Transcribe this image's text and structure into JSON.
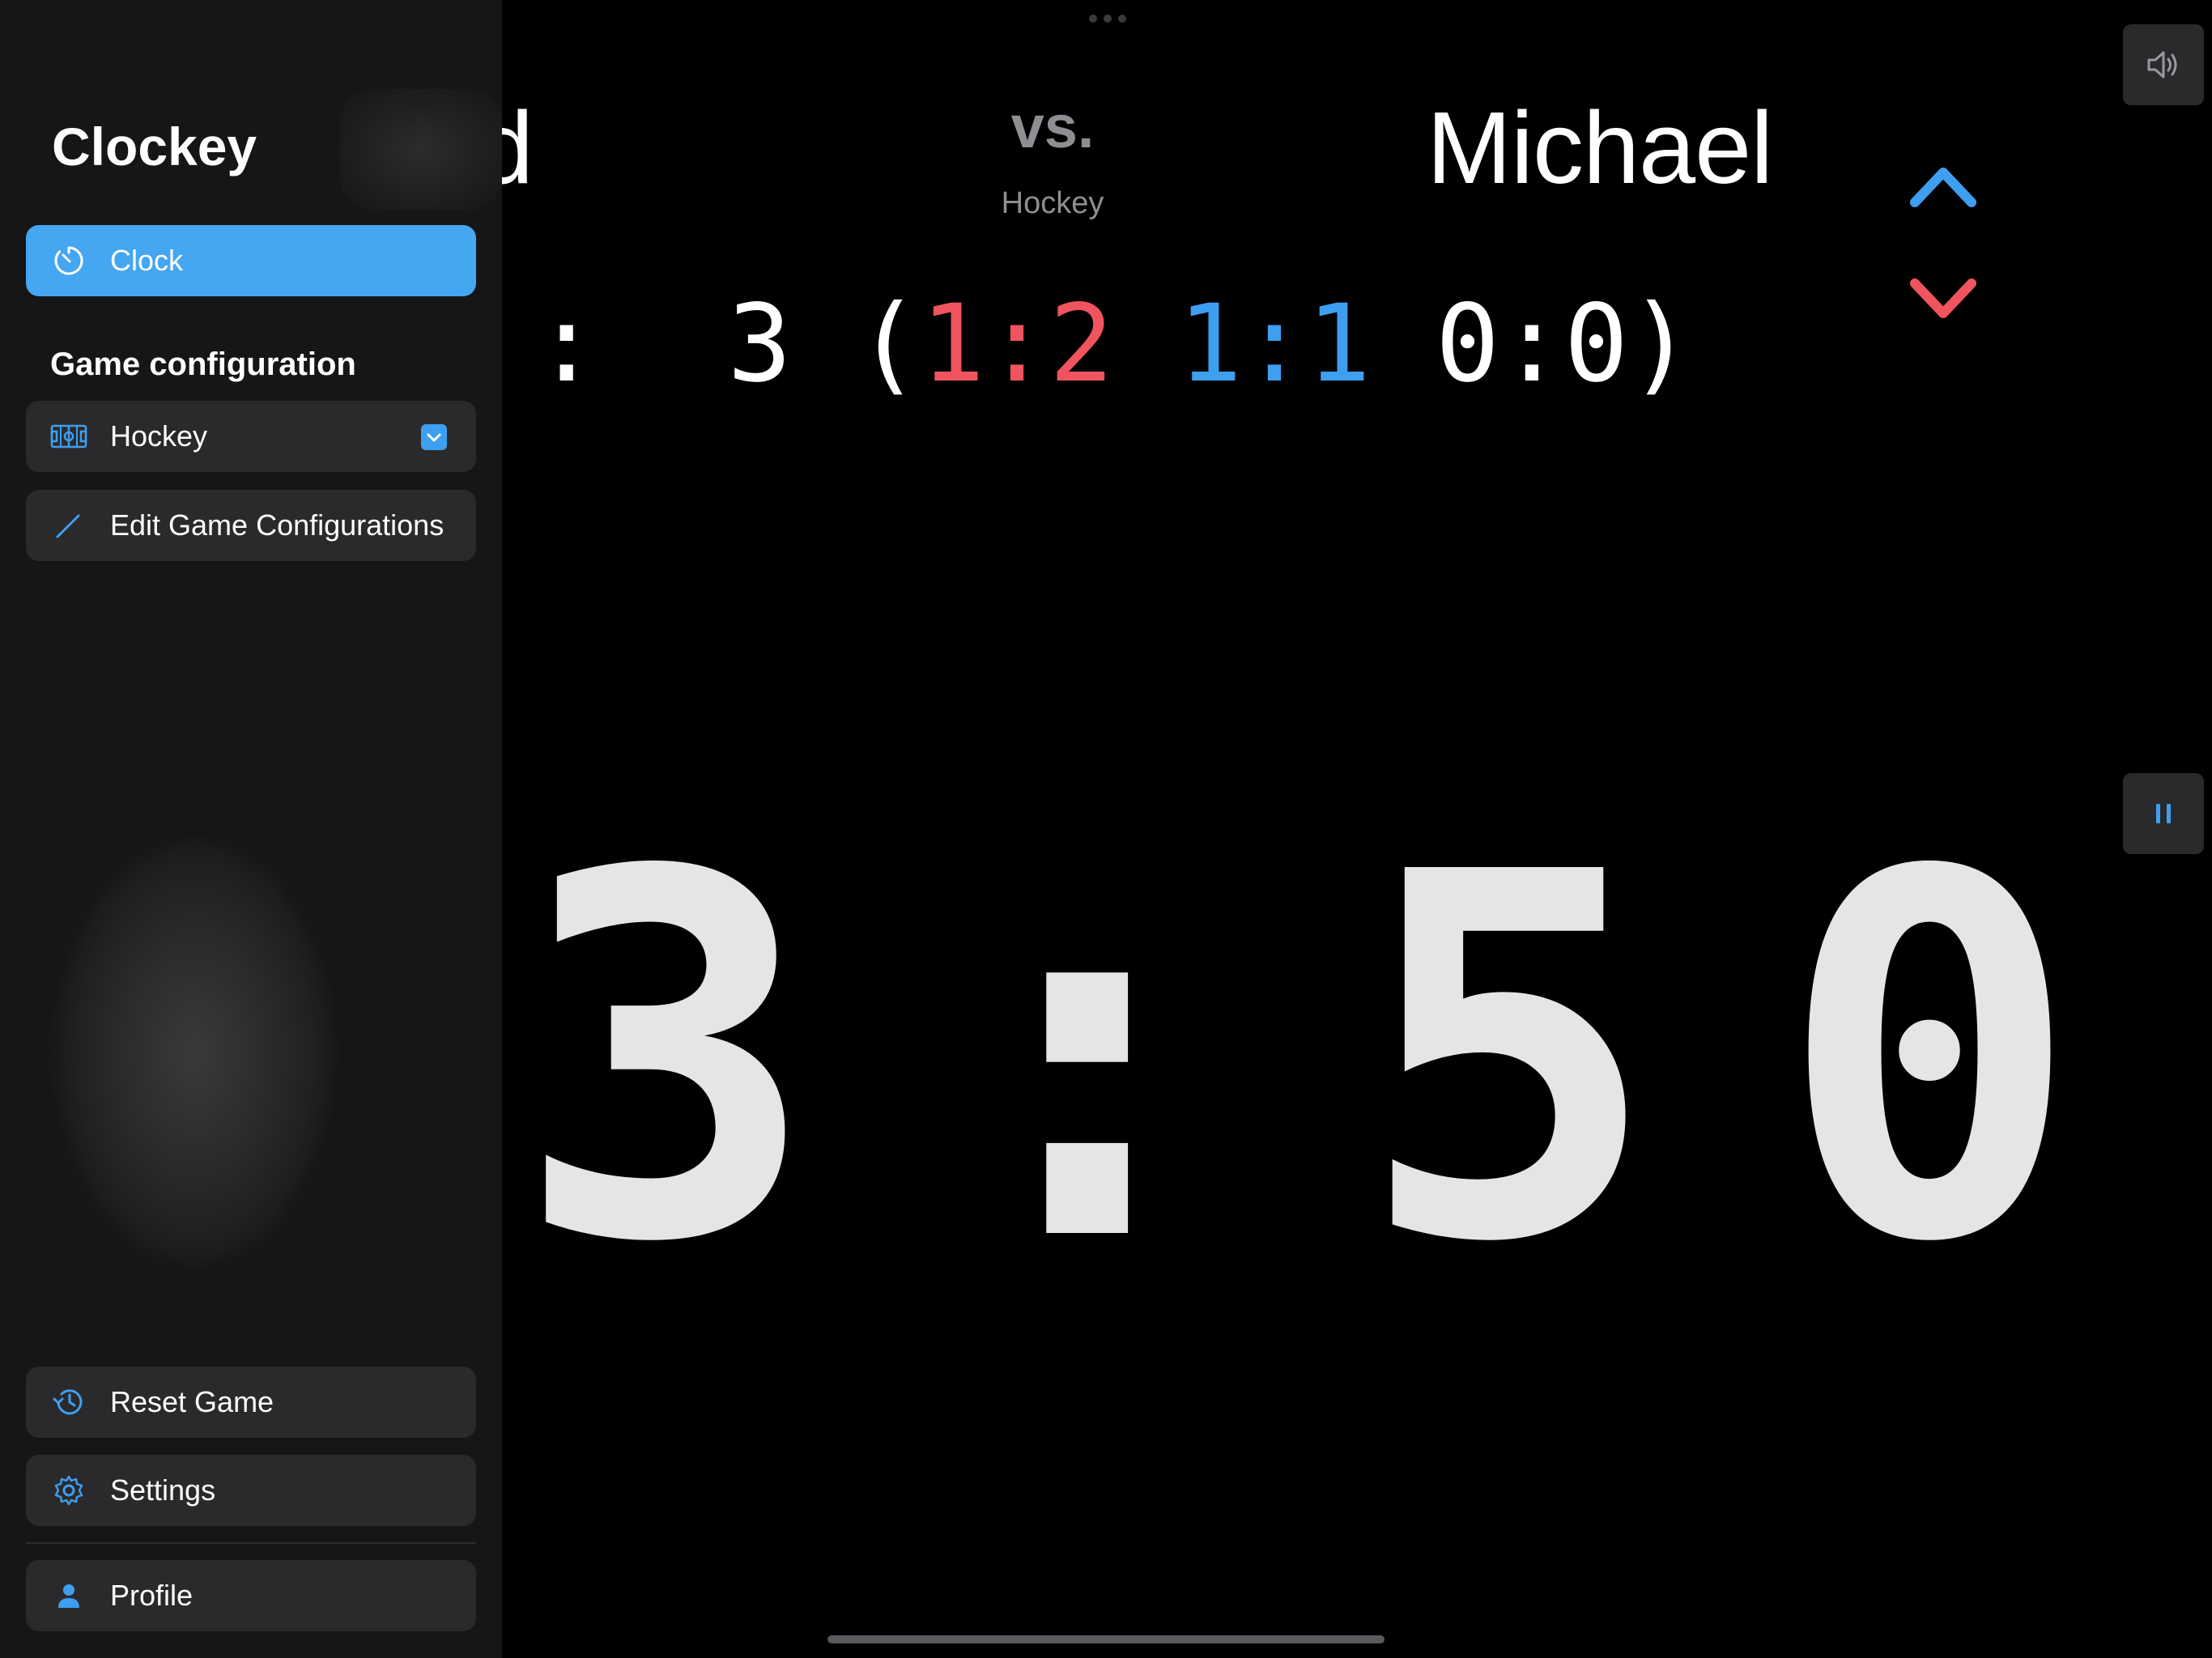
{
  "scoreboard": {
    "player_left": "vid",
    "vs": "vs.",
    "game_type": "Hockey",
    "player_right": "Michael",
    "score_line": {
      "lead_colon": ":",
      "total": "3",
      "open_paren": "(",
      "period1_left": "1",
      "period1_sep": ":",
      "period1_right": "2",
      "period2_left": "1",
      "period2_sep": ":",
      "period2_right": "1",
      "period3_left": "0",
      "period3_sep": ":",
      "period3_right": "0",
      "close_paren": ")"
    },
    "clock": {
      "minutes": "3",
      "colon": ":",
      "seconds_tens": "5",
      "seconds_ones": "0"
    },
    "colors": {
      "period1": "#f0545e",
      "period2": "#3e9ff0",
      "up_arrow": "#3e9ff0",
      "down_arrow": "#f0545e"
    },
    "icons": {
      "up": "chevron-up-icon",
      "down": "chevron-down-icon",
      "sound": "speaker-icon",
      "pause": "pause-icon"
    }
  },
  "sidebar": {
    "app_title": "Clockey",
    "clock_label": "Clock",
    "section_title": "Game configuration",
    "hockey_label": "Hockey",
    "edit_label": "Edit Game Configurations",
    "reset_label": "Reset Game",
    "settings_label": "Settings",
    "profile_label": "Profile",
    "accent_color": "#45a6f2",
    "icons": {
      "clock": "timer-icon",
      "hockey": "rink-icon",
      "edit": "pencil-icon",
      "reset": "history-icon",
      "settings": "gear-icon",
      "profile": "person-icon"
    }
  }
}
